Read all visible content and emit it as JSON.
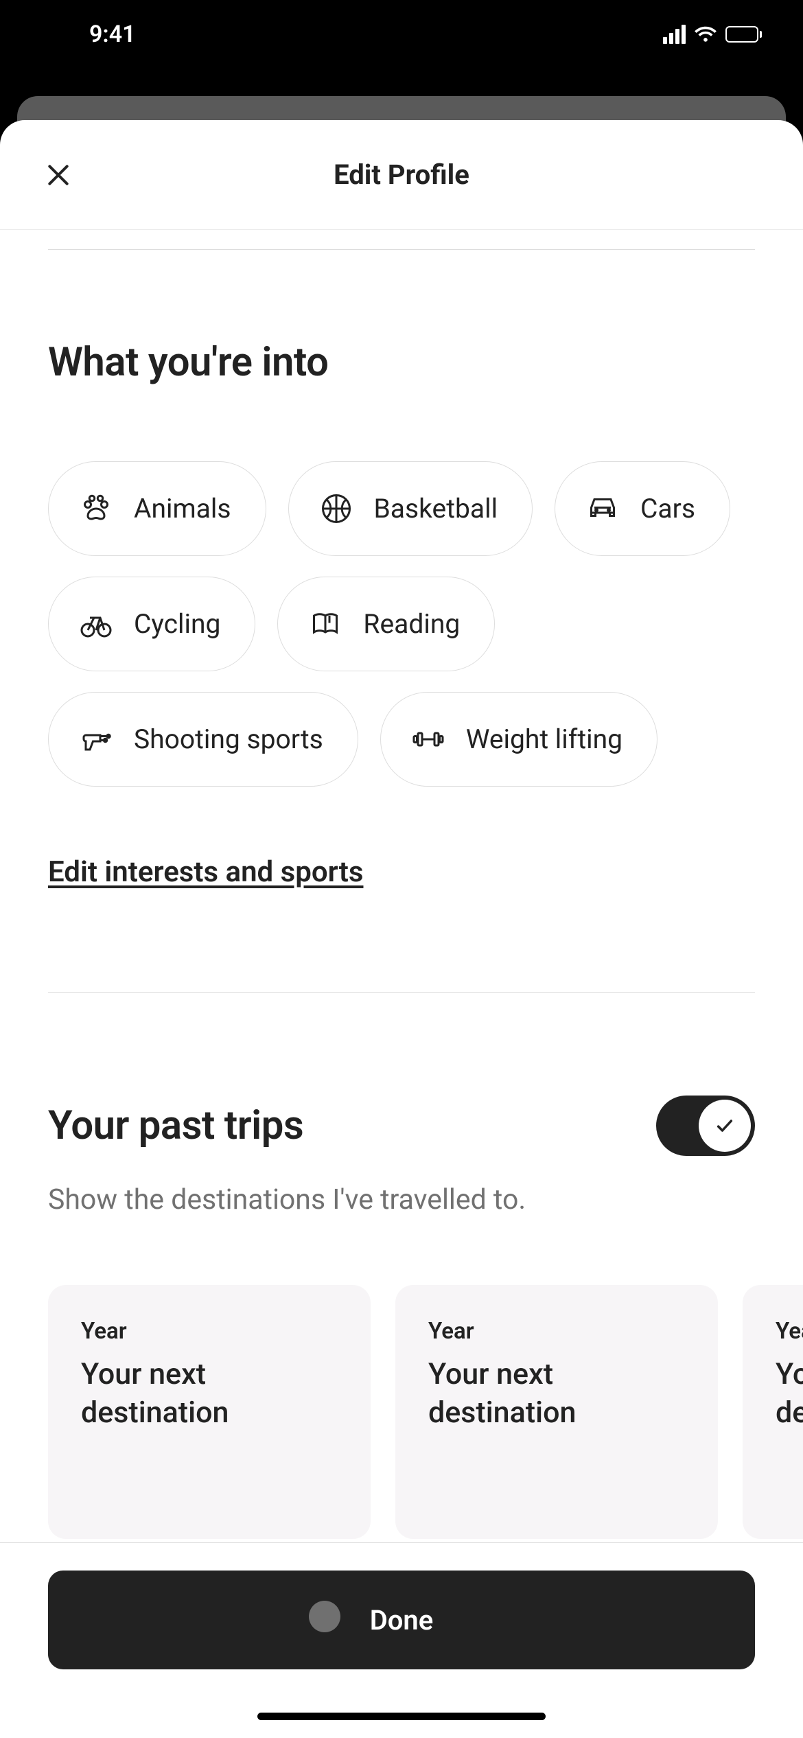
{
  "status": {
    "time": "9:41"
  },
  "sheet": {
    "title": "Edit Profile"
  },
  "interests": {
    "heading": "What you're into",
    "chips": {
      "animals": "Animals",
      "basketball": "Basketball",
      "cars": "Cars",
      "cycling": "Cycling",
      "reading": "Reading",
      "shooting": "Shooting sports",
      "weight": "Weight lifting"
    },
    "edit_link": "Edit interests and sports"
  },
  "trips": {
    "heading": "Your past trips",
    "subtitle": "Show the destinations I've travelled to.",
    "toggle_on": true,
    "cards": {
      "0": {
        "year": "Year",
        "dest": "Your next destination"
      },
      "1": {
        "year": "Year",
        "dest": "Your next destination"
      },
      "2": {
        "year": "Year",
        "dest": "Your next destination"
      }
    }
  },
  "footer": {
    "done": "Done"
  }
}
